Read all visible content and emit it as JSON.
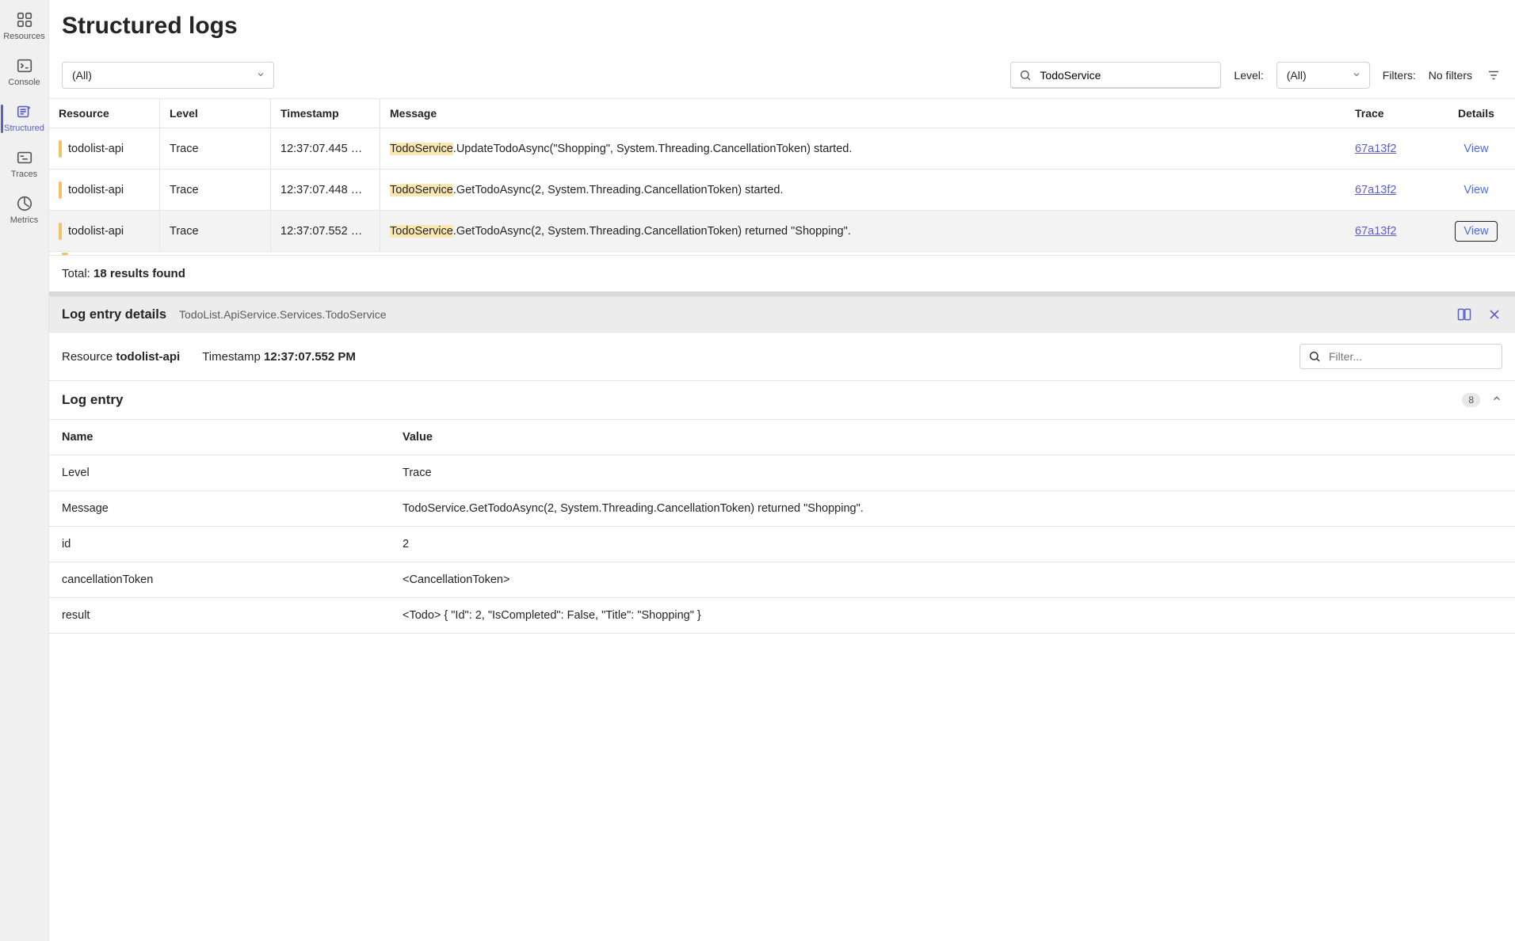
{
  "rail": {
    "items": [
      {
        "label": "Resources",
        "icon": "grid"
      },
      {
        "label": "Console",
        "icon": "console"
      },
      {
        "label": "Structured",
        "icon": "sparkle"
      },
      {
        "label": "Traces",
        "icon": "traces"
      },
      {
        "label": "Metrics",
        "icon": "metrics"
      }
    ]
  },
  "page": {
    "title": "Structured logs"
  },
  "filters": {
    "resource_select": "(All)",
    "search_value": "TodoService",
    "level_label": "Level:",
    "level_select": "(All)",
    "filters_label": "Filters:",
    "no_filters": "No filters"
  },
  "table": {
    "headers": {
      "resource": "Resource",
      "level": "Level",
      "timestamp": "Timestamp",
      "message": "Message",
      "trace": "Trace",
      "details": "Details"
    },
    "rows": [
      {
        "resource": "todolist-api",
        "level": "Trace",
        "timestamp": "12:37:07.445 …",
        "message_hl": "TodoService",
        "message_rest": ".UpdateTodoAsync(\"Shopping\", System.Threading.CancellationToken) started.",
        "trace": "67a13f2",
        "view": "View"
      },
      {
        "resource": "todolist-api",
        "level": "Trace",
        "timestamp": "12:37:07.448 …",
        "message_hl": "TodoService",
        "message_rest": ".GetTodoAsync(2, System.Threading.CancellationToken) started.",
        "trace": "67a13f2",
        "view": "View"
      },
      {
        "resource": "todolist-api",
        "level": "Trace",
        "timestamp": "12:37:07.552 …",
        "message_hl": "TodoService",
        "message_rest": ".GetTodoAsync(2, System.Threading.CancellationToken) returned \"Shopping\".",
        "trace": "67a13f2",
        "view": "View"
      }
    ],
    "totals_prefix": "Total: ",
    "totals_count": "18 results found"
  },
  "details": {
    "panel_title": "Log entry details",
    "panel_sub": "TodoList.ApiService.Services.TodoService",
    "meta_resource_label": "Resource ",
    "meta_resource_value": "todolist-api",
    "meta_ts_label": "Timestamp ",
    "meta_ts_value": "12:37:07.552 PM",
    "filter_placeholder": "Filter...",
    "section_title": "Log entry",
    "badge": "8",
    "kv_headers": {
      "name": "Name",
      "value": "Value"
    },
    "kv": [
      {
        "name": "Level",
        "value": "Trace"
      },
      {
        "name": "Message",
        "value": "TodoService.GetTodoAsync(2, System.Threading.CancellationToken) returned \"Shopping\"."
      },
      {
        "name": "id",
        "value": "2"
      },
      {
        "name": "cancellationToken",
        "value": "<CancellationToken>"
      },
      {
        "name": "result",
        "value": "<Todo> { \"Id\": 2, \"IsCompleted\": False, \"Title\": \"Shopping\" }"
      }
    ]
  }
}
